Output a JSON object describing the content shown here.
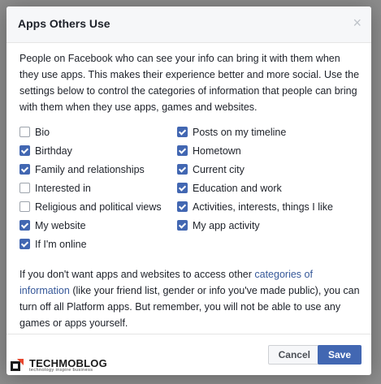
{
  "dialog": {
    "title": "Apps Others Use",
    "close_glyph": "×",
    "intro": "People on Facebook who can see your info can bring it with them when they use apps. This makes their experience better and more social. Use the settings below to control the categories of information that people can bring with them when they use apps, games and websites.",
    "options_left": [
      {
        "label": "Bio",
        "checked": false
      },
      {
        "label": "Birthday",
        "checked": true
      },
      {
        "label": "Family and relationships",
        "checked": true
      },
      {
        "label": "Interested in",
        "checked": false
      },
      {
        "label": "Religious and political views",
        "checked": false
      },
      {
        "label": "My website",
        "checked": true
      },
      {
        "label": "If I'm online",
        "checked": true
      }
    ],
    "options_right": [
      {
        "label": "Posts on my timeline",
        "checked": true
      },
      {
        "label": "Hometown",
        "checked": true
      },
      {
        "label": "Current city",
        "checked": true
      },
      {
        "label": "Education and work",
        "checked": true
      },
      {
        "label": "Activities, interests, things I like",
        "checked": true
      },
      {
        "label": "My app activity",
        "checked": true
      }
    ],
    "note_before": "If you don't want apps and websites to access other ",
    "note_link": "categories of information",
    "note_after": " (like your friend list, gender or info you've made public), you can turn off all Platform apps. But remember, you will not be able to use any games or apps yourself.",
    "cancel_label": "Cancel",
    "save_label": "Save"
  },
  "watermark": {
    "brand": "TECHMOBLOG",
    "tagline": "technology inspire business"
  },
  "colors": {
    "accent": "#4267b2",
    "link": "#365899"
  }
}
